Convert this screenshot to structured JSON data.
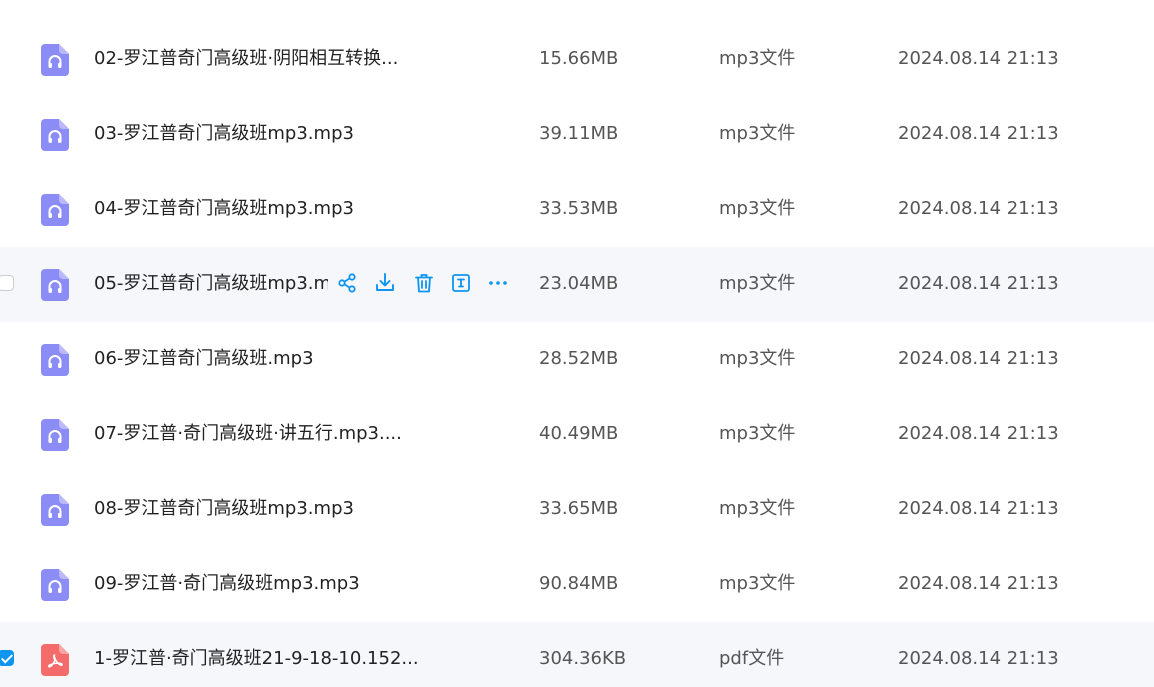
{
  "rows": [
    {
      "name": "02-罗江普奇门高级班·阴阳相互转换...",
      "size": "15.66MB",
      "type": "mp3文件",
      "time": "2024.08.14 21:13",
      "icon": "audio-file-icon"
    },
    {
      "name": "03-罗江普奇门高级班mp3.mp3",
      "size": "39.11MB",
      "type": "mp3文件",
      "time": "2024.08.14 21:13",
      "icon": "audio-file-icon"
    },
    {
      "name": "04-罗江普奇门高级班mp3.mp3",
      "size": "33.53MB",
      "type": "mp3文件",
      "time": "2024.08.14 21:13",
      "icon": "audio-file-icon"
    },
    {
      "name": "05-罗江普奇门高级班mp3.mp3",
      "size": "23.04MB",
      "type": "mp3文件",
      "time": "2024.08.14 21:13",
      "icon": "audio-file-icon"
    },
    {
      "name": "06-罗江普奇门高级班.mp3",
      "size": "28.52MB",
      "type": "mp3文件",
      "time": "2024.08.14 21:13",
      "icon": "audio-file-icon"
    },
    {
      "name": "07-罗江普·奇门高级班·讲五行.mp3....",
      "size": "40.49MB",
      "type": "mp3文件",
      "time": "2024.08.14 21:13",
      "icon": "audio-file-icon"
    },
    {
      "name": "08-罗江普奇门高级班mp3.mp3",
      "size": "33.65MB",
      "type": "mp3文件",
      "time": "2024.08.14 21:13",
      "icon": "audio-file-icon"
    },
    {
      "name": "09-罗江普·奇门高级班mp3.mp3",
      "size": "90.84MB",
      "type": "mp3文件",
      "time": "2024.08.14 21:13",
      "icon": "audio-file-icon"
    },
    {
      "name": "1-罗江普·奇门高级班21-9-18-10.152...",
      "size": "304.36KB",
      "type": "pdf文件",
      "time": "2024.08.14 21:13",
      "icon": "pdf-file-icon"
    }
  ],
  "hover_actions": [
    "share-icon",
    "download-icon",
    "delete-icon",
    "rename-icon",
    "more-icon"
  ],
  "colors": {
    "audio_icon": "#8c8cf6",
    "pdf_icon": "#f46b6b",
    "accent": "#0d95f0",
    "hover_row": "#f5f7fa"
  }
}
